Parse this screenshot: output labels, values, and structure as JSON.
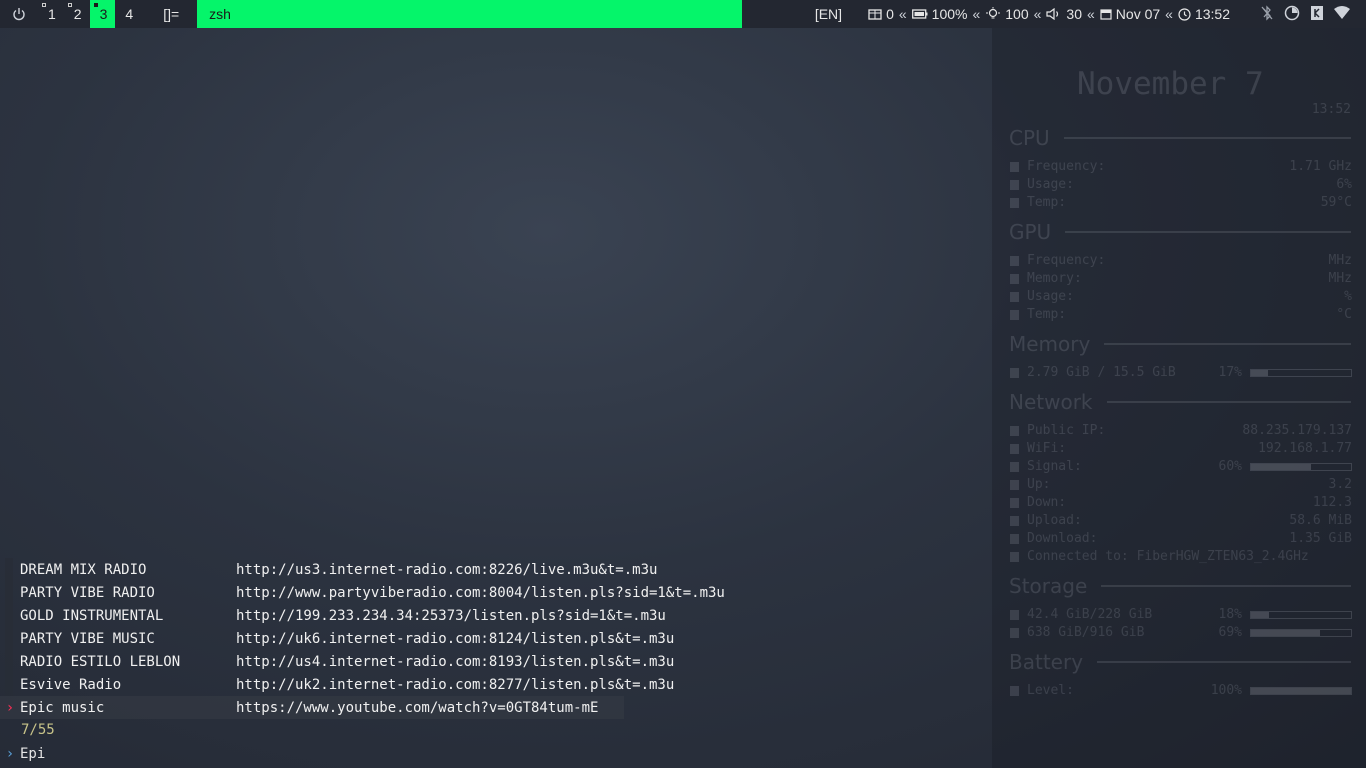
{
  "topbar": {
    "workspaces": [
      {
        "label": "1",
        "active": false
      },
      {
        "label": "2",
        "active": false
      },
      {
        "label": "3",
        "active": true
      },
      {
        "label": "4",
        "active": false
      }
    ],
    "layout": "[]=",
    "window_title": "zsh",
    "lang": "[EN]",
    "updates": "0",
    "battery": "100%",
    "brightness": "100",
    "volume": "30",
    "date": "Nov 07",
    "time": "13:52",
    "separator": "«",
    "icons": [
      "power-icon",
      "package-icon",
      "battery-icon",
      "bulb-icon",
      "volume-icon",
      "calendar-icon",
      "clock-icon",
      "bluetooth-off-icon",
      "cpu-dial-icon",
      "keepass-icon",
      "wifi-icon"
    ],
    "accent": "#05f56a"
  },
  "conky": {
    "date": "November 7",
    "time": "13:52",
    "cpu": {
      "title": "CPU",
      "freq_label": "Frequency:",
      "freq": "1.71 GHz",
      "usage_label": "Usage:",
      "usage": "6%",
      "temp_label": "Temp:",
      "temp": "59°C"
    },
    "gpu": {
      "title": "GPU",
      "freq_label": "Frequency:",
      "freq": "MHz",
      "mem_label": "Memory:",
      "mem": "MHz",
      "usage_label": "Usage:",
      "usage": "%",
      "temp_label": "Temp:",
      "temp": "°C"
    },
    "memory": {
      "title": "Memory",
      "value": "2.79 GiB / 15.5 GiB",
      "percent": "17%",
      "fill": 0.17
    },
    "network": {
      "title": "Network",
      "public_label": "Public IP:",
      "public": "88.235.179.137",
      "wifi_label": "WiFi:",
      "wifi": "192.168.1.77",
      "signal_label": "Signal:",
      "signal": "60%",
      "signal_fill": 0.6,
      "up_label": "Up:",
      "up": "3.2",
      "down_label": "Down:",
      "down": "112.3",
      "upload_label": "Upload:",
      "upload": "58.6 MiB",
      "download_label": "Download:",
      "download": "1.35 GiB",
      "connected": "Connected to: FiberHGW_ZTEN63_2.4GHz"
    },
    "storage": {
      "title": "Storage",
      "disk1": "42.4 GiB/228 GiB",
      "disk1_pct": "18%",
      "disk1_fill": 0.18,
      "disk2": "638 GiB/916 GiB",
      "disk2_pct": "69%",
      "disk2_fill": 0.69
    },
    "battery": {
      "title": "Battery",
      "level_label": "Level:",
      "level": "100%",
      "fill": 1.0
    }
  },
  "fzf": {
    "rows": [
      {
        "name": "DREAM MIX RADIO",
        "url": "http://us3.internet-radio.com:8226/live.m3u&t=.m3u",
        "selected": false
      },
      {
        "name": "PARTY VIBE RADIO",
        "url": "http://www.partyviberadio.com:8004/listen.pls?sid=1&t=.m3u",
        "selected": false
      },
      {
        "name": "GOLD INSTRUMENTAL",
        "url": "http://199.233.234.34:25373/listen.pls?sid=1&t=.m3u",
        "selected": false
      },
      {
        "name": "PARTY VIBE MUSIC",
        "url": "http://uk6.internet-radio.com:8124/listen.pls&t=.m3u",
        "selected": false
      },
      {
        "name": "RADIO ESTILO LEBLON",
        "url": "http://us4.internet-radio.com:8193/listen.pls&t=.m3u",
        "selected": false
      },
      {
        "name": "Esvive Radio",
        "url": "http://uk2.internet-radio.com:8277/listen.pls&t=.m3u",
        "selected": false
      },
      {
        "name": "Epic music",
        "url": "https://www.youtube.com/watch?v=0GT84tum-mE",
        "selected": true
      }
    ],
    "pointer": "›",
    "count": "7/55",
    "prompt_symbol": "›",
    "query": "Epi"
  }
}
